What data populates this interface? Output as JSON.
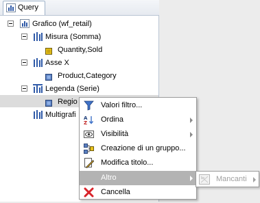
{
  "tab": {
    "label": "Query"
  },
  "tree": {
    "root": "Grafico (wf_retail)",
    "measure": "Misura (Somma)",
    "measure_field": "Quantity,Sold",
    "xaxis": "Asse X",
    "xaxis_field": "Product,Category",
    "legend": "Legenda (Serie)",
    "legend_field": "Regio",
    "multigraph": "Multigrafi"
  },
  "menu": {
    "items": [
      {
        "label": "Valori filtro...",
        "icon": "filter-icon"
      },
      {
        "label": "Ordina",
        "icon": "sort-az-icon",
        "submenu": true
      },
      {
        "label": "Visibilità",
        "icon": "visibility-icon",
        "submenu": true
      },
      {
        "label": "Creazione di un gruppo...",
        "icon": "group-icon"
      },
      {
        "label": "Modifica titolo...",
        "icon": "edit-title-icon"
      },
      {
        "label": "Altro",
        "icon": "",
        "submenu": true,
        "active": true
      },
      {
        "label": "Cancella",
        "icon": "delete-x-icon"
      }
    ]
  },
  "submenu": {
    "label": "Mancanti",
    "icon": "missing-icon"
  },
  "colors": {
    "accent_blue": "#2f5aa8",
    "delete_red": "#d8232a",
    "active_item": "#b3b3b3"
  }
}
